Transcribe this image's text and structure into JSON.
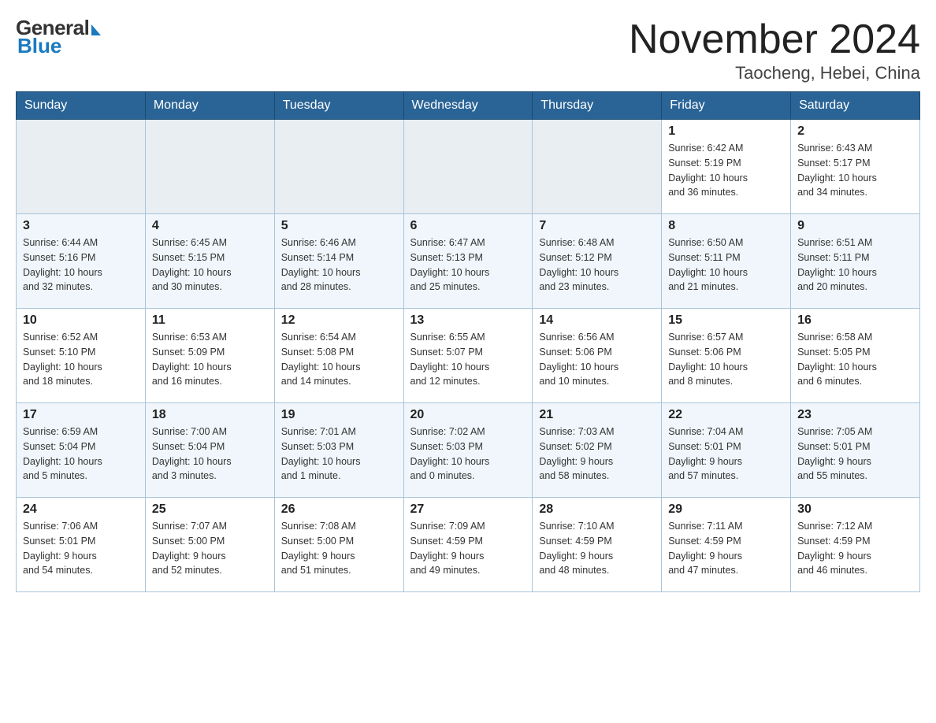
{
  "header": {
    "logo_general": "General",
    "logo_blue": "Blue",
    "month_title": "November 2024",
    "location": "Taocheng, Hebei, China"
  },
  "days_of_week": [
    "Sunday",
    "Monday",
    "Tuesday",
    "Wednesday",
    "Thursday",
    "Friday",
    "Saturday"
  ],
  "weeks": [
    [
      {
        "day": "",
        "info": ""
      },
      {
        "day": "",
        "info": ""
      },
      {
        "day": "",
        "info": ""
      },
      {
        "day": "",
        "info": ""
      },
      {
        "day": "",
        "info": ""
      },
      {
        "day": "1",
        "info": "Sunrise: 6:42 AM\nSunset: 5:19 PM\nDaylight: 10 hours\nand 36 minutes."
      },
      {
        "day": "2",
        "info": "Sunrise: 6:43 AM\nSunset: 5:17 PM\nDaylight: 10 hours\nand 34 minutes."
      }
    ],
    [
      {
        "day": "3",
        "info": "Sunrise: 6:44 AM\nSunset: 5:16 PM\nDaylight: 10 hours\nand 32 minutes."
      },
      {
        "day": "4",
        "info": "Sunrise: 6:45 AM\nSunset: 5:15 PM\nDaylight: 10 hours\nand 30 minutes."
      },
      {
        "day": "5",
        "info": "Sunrise: 6:46 AM\nSunset: 5:14 PM\nDaylight: 10 hours\nand 28 minutes."
      },
      {
        "day": "6",
        "info": "Sunrise: 6:47 AM\nSunset: 5:13 PM\nDaylight: 10 hours\nand 25 minutes."
      },
      {
        "day": "7",
        "info": "Sunrise: 6:48 AM\nSunset: 5:12 PM\nDaylight: 10 hours\nand 23 minutes."
      },
      {
        "day": "8",
        "info": "Sunrise: 6:50 AM\nSunset: 5:11 PM\nDaylight: 10 hours\nand 21 minutes."
      },
      {
        "day": "9",
        "info": "Sunrise: 6:51 AM\nSunset: 5:11 PM\nDaylight: 10 hours\nand 20 minutes."
      }
    ],
    [
      {
        "day": "10",
        "info": "Sunrise: 6:52 AM\nSunset: 5:10 PM\nDaylight: 10 hours\nand 18 minutes."
      },
      {
        "day": "11",
        "info": "Sunrise: 6:53 AM\nSunset: 5:09 PM\nDaylight: 10 hours\nand 16 minutes."
      },
      {
        "day": "12",
        "info": "Sunrise: 6:54 AM\nSunset: 5:08 PM\nDaylight: 10 hours\nand 14 minutes."
      },
      {
        "day": "13",
        "info": "Sunrise: 6:55 AM\nSunset: 5:07 PM\nDaylight: 10 hours\nand 12 minutes."
      },
      {
        "day": "14",
        "info": "Sunrise: 6:56 AM\nSunset: 5:06 PM\nDaylight: 10 hours\nand 10 minutes."
      },
      {
        "day": "15",
        "info": "Sunrise: 6:57 AM\nSunset: 5:06 PM\nDaylight: 10 hours\nand 8 minutes."
      },
      {
        "day": "16",
        "info": "Sunrise: 6:58 AM\nSunset: 5:05 PM\nDaylight: 10 hours\nand 6 minutes."
      }
    ],
    [
      {
        "day": "17",
        "info": "Sunrise: 6:59 AM\nSunset: 5:04 PM\nDaylight: 10 hours\nand 5 minutes."
      },
      {
        "day": "18",
        "info": "Sunrise: 7:00 AM\nSunset: 5:04 PM\nDaylight: 10 hours\nand 3 minutes."
      },
      {
        "day": "19",
        "info": "Sunrise: 7:01 AM\nSunset: 5:03 PM\nDaylight: 10 hours\nand 1 minute."
      },
      {
        "day": "20",
        "info": "Sunrise: 7:02 AM\nSunset: 5:03 PM\nDaylight: 10 hours\nand 0 minutes."
      },
      {
        "day": "21",
        "info": "Sunrise: 7:03 AM\nSunset: 5:02 PM\nDaylight: 9 hours\nand 58 minutes."
      },
      {
        "day": "22",
        "info": "Sunrise: 7:04 AM\nSunset: 5:01 PM\nDaylight: 9 hours\nand 57 minutes."
      },
      {
        "day": "23",
        "info": "Sunrise: 7:05 AM\nSunset: 5:01 PM\nDaylight: 9 hours\nand 55 minutes."
      }
    ],
    [
      {
        "day": "24",
        "info": "Sunrise: 7:06 AM\nSunset: 5:01 PM\nDaylight: 9 hours\nand 54 minutes."
      },
      {
        "day": "25",
        "info": "Sunrise: 7:07 AM\nSunset: 5:00 PM\nDaylight: 9 hours\nand 52 minutes."
      },
      {
        "day": "26",
        "info": "Sunrise: 7:08 AM\nSunset: 5:00 PM\nDaylight: 9 hours\nand 51 minutes."
      },
      {
        "day": "27",
        "info": "Sunrise: 7:09 AM\nSunset: 4:59 PM\nDaylight: 9 hours\nand 49 minutes."
      },
      {
        "day": "28",
        "info": "Sunrise: 7:10 AM\nSunset: 4:59 PM\nDaylight: 9 hours\nand 48 minutes."
      },
      {
        "day": "29",
        "info": "Sunrise: 7:11 AM\nSunset: 4:59 PM\nDaylight: 9 hours\nand 47 minutes."
      },
      {
        "day": "30",
        "info": "Sunrise: 7:12 AM\nSunset: 4:59 PM\nDaylight: 9 hours\nand 46 minutes."
      }
    ]
  ]
}
